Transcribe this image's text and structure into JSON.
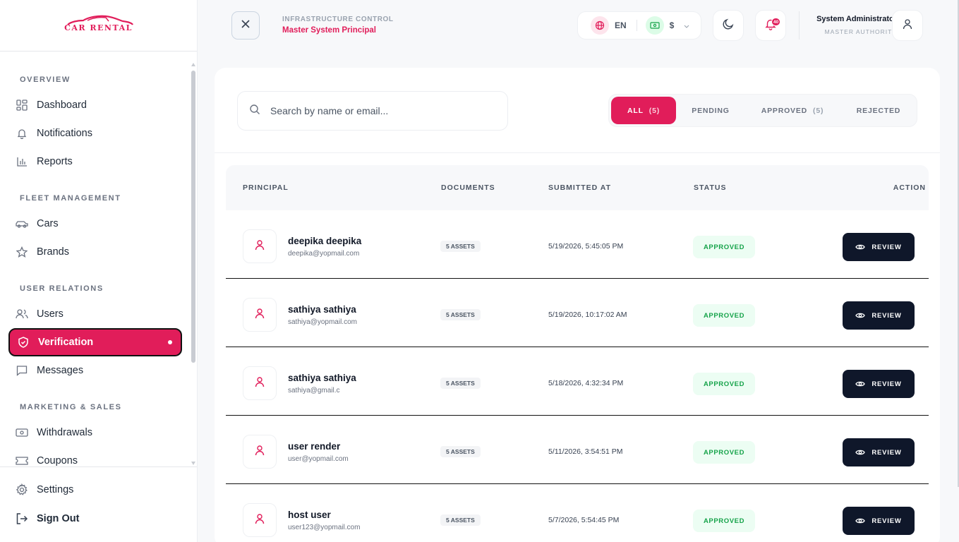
{
  "brand": {
    "name": "CAR RENTAL",
    "accent": "#e11d5a"
  },
  "sidebar": {
    "sections": [
      {
        "label": "OVERVIEW"
      },
      {
        "label": "FLEET MANAGEMENT"
      },
      {
        "label": "USER RELATIONS"
      },
      {
        "label": "MARKETING & SALES"
      }
    ],
    "items": [
      {
        "label": "Dashboard",
        "icon": "dashboard-icon"
      },
      {
        "label": "Notifications",
        "icon": "bell-icon"
      },
      {
        "label": "Reports",
        "icon": "bar-chart-icon"
      },
      {
        "label": "Cars",
        "icon": "car-icon"
      },
      {
        "label": "Brands",
        "icon": "star-icon"
      },
      {
        "label": "Users",
        "icon": "users-icon"
      },
      {
        "label": "Verification",
        "icon": "shield-check-icon",
        "active": true
      },
      {
        "label": "Messages",
        "icon": "message-icon"
      },
      {
        "label": "Withdrawals",
        "icon": "banknote-icon"
      },
      {
        "label": "Coupons",
        "icon": "ticket-icon"
      }
    ],
    "bottom": [
      {
        "label": "Settings",
        "icon": "gear-icon"
      },
      {
        "label": "Sign Out",
        "icon": "sign-out-icon"
      }
    ]
  },
  "header": {
    "kicker": "INFRASTRUCTURE CONTROL",
    "subtitle": "Master System Principal",
    "language": "EN",
    "currency": "$",
    "notification_count": "40",
    "admin_name": "System Administrator",
    "admin_role": "MASTER AUTHORITY"
  },
  "search": {
    "placeholder": "Search by name or email..."
  },
  "tabs": [
    {
      "label": "ALL",
      "count": "(5)",
      "active": true
    },
    {
      "label": "PENDING",
      "count": ""
    },
    {
      "label": "APPROVED",
      "count": "(5)"
    },
    {
      "label": "REJECTED",
      "count": ""
    }
  ],
  "table": {
    "columns": [
      "PRINCIPAL",
      "DOCUMENTS",
      "SUBMITTED AT",
      "STATUS",
      "ACTION"
    ],
    "rows": [
      {
        "name": "deepika deepika",
        "email": "deepika@yopmail.com",
        "documents": "5 ASSETS",
        "submitted": "5/19/2026, 5:45:05 PM",
        "status": "APPROVED",
        "action": "REVIEW"
      },
      {
        "name": "sathiya sathiya",
        "email": "sathiya@yopmail.com",
        "documents": "5 ASSETS",
        "submitted": "5/19/2026, 10:17:02 AM",
        "status": "APPROVED",
        "action": "REVIEW"
      },
      {
        "name": "sathiya sathiya",
        "email": "sathiya@gmail.c",
        "documents": "5 ASSETS",
        "submitted": "5/18/2026, 4:32:34 PM",
        "status": "APPROVED",
        "action": "REVIEW"
      },
      {
        "name": "user render",
        "email": "user@yopmail.com",
        "documents": "5 ASSETS",
        "submitted": "5/11/2026, 3:54:51 PM",
        "status": "APPROVED",
        "action": "REVIEW"
      },
      {
        "name": "host user",
        "email": "user123@yopmail.com",
        "documents": "5 ASSETS",
        "submitted": "5/7/2026, 5:54:45 PM",
        "status": "APPROVED",
        "action": "REVIEW"
      }
    ]
  }
}
